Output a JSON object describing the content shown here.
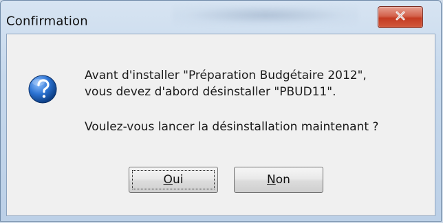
{
  "window": {
    "title": "Confirmation"
  },
  "message": {
    "line1": "Avant d'installer \"Préparation Budgétaire 2012\",",
    "line2": "vous devez d'abord désinstaller \"PBUD11\".",
    "line3": "Voulez-vous lancer la désinstallation maintenant ?"
  },
  "buttons": {
    "yes_mnemonic": "O",
    "yes_rest": "ui",
    "no_mnemonic": "N",
    "no_rest": "on"
  },
  "icons": {
    "message_icon": "question-icon",
    "close_icon": "close-icon"
  },
  "colors": {
    "close_button": "#c43b22",
    "question_icon": "#1d62b5"
  }
}
